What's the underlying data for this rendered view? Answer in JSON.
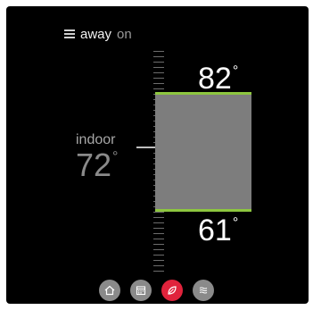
{
  "menu": {
    "away_label": "away",
    "away_state": "on"
  },
  "setpoints": {
    "cool": "82",
    "heat": "61",
    "degree_symbol": "°"
  },
  "indoor": {
    "label": "indoor",
    "value": "72",
    "degree_symbol": "°"
  },
  "colors": {
    "accent_green": "#8dc63f",
    "active_red": "#e0233c",
    "range_fill": "#7d7d7d"
  },
  "nav": {
    "items": [
      {
        "icon": "home-icon",
        "active": false
      },
      {
        "icon": "calendar-icon",
        "active": false
      },
      {
        "icon": "leaf-icon",
        "active": true
      },
      {
        "icon": "fan-icon",
        "active": false
      }
    ]
  }
}
